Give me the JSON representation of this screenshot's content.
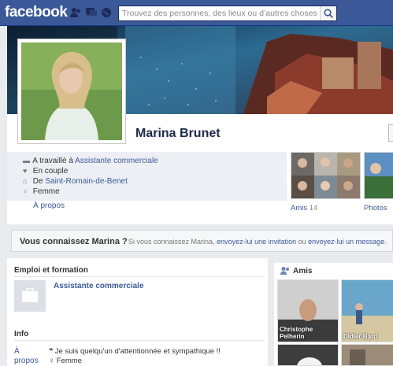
{
  "topbar": {
    "logo": "facebook",
    "search_placeholder": "Trouvez des personnes, des lieux ou d’autres choses",
    "icons": [
      "friend-requests-icon",
      "messages-icon",
      "notifications-icon",
      "search-icon"
    ],
    "color": "#3b5998"
  },
  "profile": {
    "name": "Marina Brunet",
    "details": [
      {
        "icon": "briefcase-icon",
        "prefix": "A travaillé à ",
        "link": "Assistante commerciale"
      },
      {
        "icon": "heart-icon",
        "prefix": "En couple",
        "link": ""
      },
      {
        "icon": "house-icon",
        "prefix": "De ",
        "link": "Saint-Romain-de-Benet"
      },
      {
        "icon": "gender-icon",
        "prefix": "Femme",
        "link": ""
      }
    ],
    "apropos": "À propos",
    "tiles": [
      {
        "label": "Amis",
        "count": "14"
      },
      {
        "label": "Photos",
        "count": ""
      }
    ]
  },
  "know": {
    "title": "Vous connaissez Marina ?",
    "text_prefix": "Si vous connaissez Marina, ",
    "invite_link": "envoyez-lui une invitation",
    "or": " ou ",
    "message_link": "envoyez-lui un message",
    "end": "."
  },
  "work": {
    "heading": "Emploi et formation",
    "job": "Assistante commerciale"
  },
  "info": {
    "heading": "Info",
    "apropos_word1": "À",
    "apropos_word2": "propos",
    "quote": "Je suis quelqu'un d'attentionnée et sympathique !!",
    "gender": "Femme"
  },
  "friends": {
    "heading": "Amis",
    "names": [
      "Christophe Pelherin",
      "Didier Bard"
    ]
  }
}
